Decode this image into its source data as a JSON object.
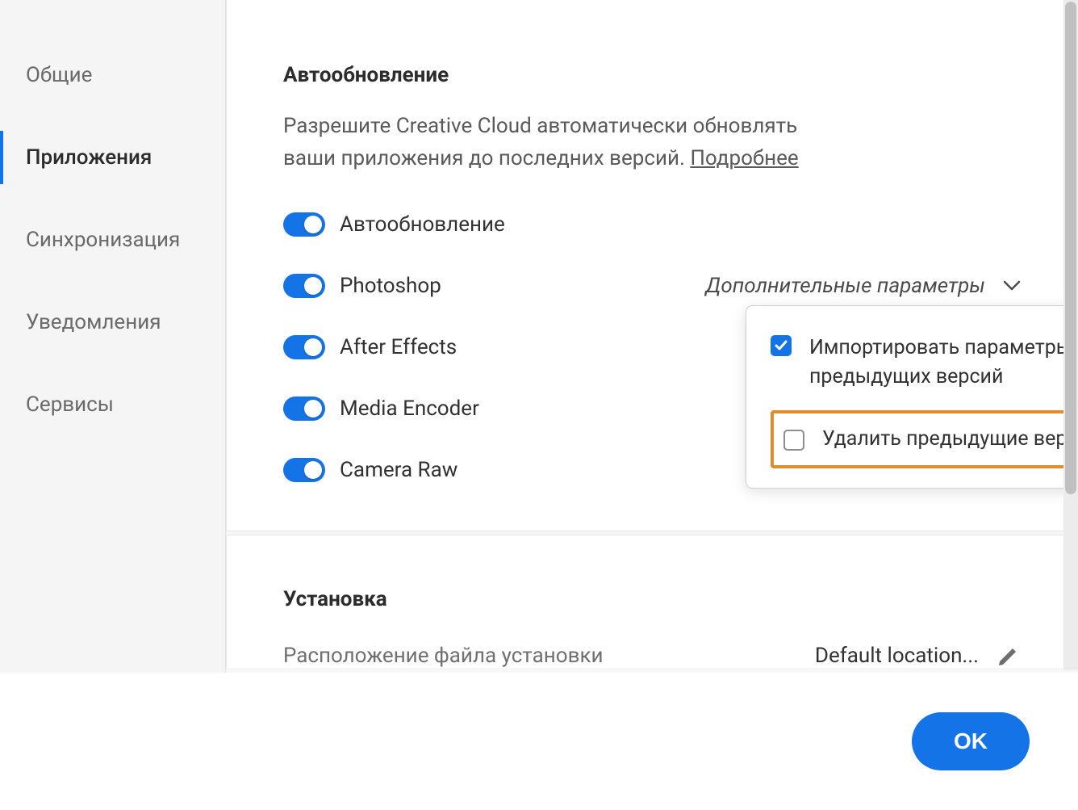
{
  "sidebar": {
    "items": [
      {
        "label": "Общие"
      },
      {
        "label": "Приложения"
      },
      {
        "label": "Синхронизация"
      },
      {
        "label": "Уведомления"
      },
      {
        "label": "Сервисы"
      }
    ]
  },
  "autoupdate": {
    "title": "Автообновление",
    "desc_prefix": "Разрешите Creative Cloud автоматически обновлять ваши приложения до последних версий. ",
    "learn_more": "Подробнее",
    "master_label": "Автообновление",
    "apps": [
      {
        "label": "Photoshop"
      },
      {
        "label": "After Effects"
      },
      {
        "label": "Media Encoder"
      },
      {
        "label": "Camera Raw"
      }
    ],
    "advanced_label": "Дополнительные параметры"
  },
  "popover": {
    "import_label": "Импортировать параметры предыдущих версий",
    "remove_label": "Удалить предыдущие версии"
  },
  "install": {
    "title": "Установка",
    "location_label": "Расположение файла установки",
    "location_value": "Default location..."
  },
  "footer": {
    "ok": "OK"
  }
}
